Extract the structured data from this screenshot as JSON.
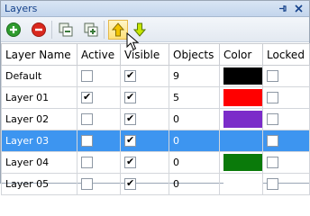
{
  "window": {
    "title": "Layers",
    "pin_glyph": "⊣",
    "close_glyph": "×"
  },
  "toolbar": {
    "buttons": [
      {
        "icon": "add-layer-icon",
        "color": "#2e9b2e"
      },
      {
        "icon": "delete-layer-icon",
        "color": "#d9281e"
      },
      {
        "icon": "copy-layer-icon",
        "color": "#3a7a3a"
      },
      {
        "icon": "paste-layer-icon",
        "color": "#3a7a3a"
      },
      {
        "icon": "move-up-icon",
        "color": "#c8a000",
        "active": true
      },
      {
        "icon": "move-down-icon",
        "color": "#58a000"
      }
    ]
  },
  "table": {
    "columns": [
      "Layer Name",
      "Active",
      "Visible",
      "Objects",
      "Color",
      "Locked"
    ],
    "rows": [
      {
        "name": "Default",
        "active": false,
        "visible": true,
        "objects": "9",
        "color": "#000000",
        "locked": false
      },
      {
        "name": "Layer 01",
        "active": true,
        "visible": true,
        "objects": "5",
        "color": "#ff0000",
        "locked": false
      },
      {
        "name": "Layer 02",
        "active": false,
        "visible": true,
        "objects": "0",
        "color": "#7b2cc9",
        "locked": false
      },
      {
        "name": "Layer 03",
        "active": false,
        "visible": true,
        "objects": "0",
        "color": "#3d95f0",
        "locked": false,
        "selected": true
      },
      {
        "name": "Layer 04",
        "active": false,
        "visible": true,
        "objects": "0",
        "color": "#0a7a0a",
        "locked": false
      },
      {
        "name": "Layer 05",
        "active": false,
        "visible": true,
        "objects": "0",
        "color": "#ffffff",
        "locked": false
      }
    ]
  },
  "colors": {
    "selection": "#3d95f0",
    "title_text": "#15428b"
  }
}
